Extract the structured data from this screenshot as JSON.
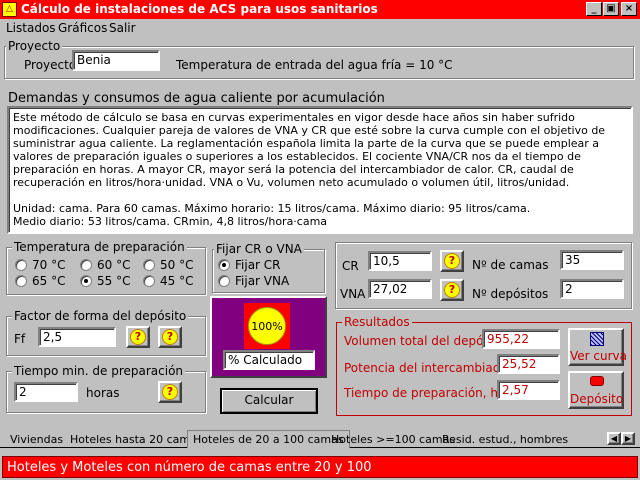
{
  "window": {
    "title": "Cálculo de instalaciones de ACS para usos sanitarios",
    "icon": "app-icon"
  },
  "menu": [
    "Listados",
    "Gráficos",
    "Salir"
  ],
  "proyecto": {
    "legend": "Proyecto",
    "label": "Proyecto:",
    "value": "Benia",
    "temp_text": "Temperatura de entrada del agua fría = 10 °C"
  },
  "demandas": {
    "heading": "Demandas y consumos de agua caliente por acumulación",
    "paragraph1": "Este método de cálculo se basa en curvas experimentales en vigor desde hace años sin haber sufrido modificaciones. Cualquier pareja de valores de VNA y CR que esté sobre la curva cumple con el objetivo de suministrar agua caliente. La reglamentación española limita la parte de la curva que se puede emplear a valores de preparación iguales o superiores a los establecidos. El cociente VNA/CR nos da el tiempo de preparación en horas. A mayor CR, mayor será la potencia del intercambiador de calor. CR, caudal de recuperación en litros/hora·unidad. VNA o Vu, volumen neto acumulado o volumen útil, litros/unidad.",
    "paragraph2_line1": "Unidad: cama. Para 60 camas. Máximo horario: 15 litros/cama. Máximo diario: 95 litros/cama.",
    "paragraph2_line2": "Medio diario: 53 litros/cama. CRmin, 4,8 litros/hora·cama"
  },
  "temperatura": {
    "legend": "Temperatura de preparación",
    "options": [
      {
        "label": "70 °C",
        "selected": false
      },
      {
        "label": "60 °C",
        "selected": false
      },
      {
        "label": "50 °C",
        "selected": false
      },
      {
        "label": "65 °C",
        "selected": false
      },
      {
        "label": "55 °C",
        "selected": true
      },
      {
        "label": "45 °C",
        "selected": false
      }
    ]
  },
  "fijar": {
    "legend": "Fijar CR o VNA",
    "options": [
      {
        "label": "Fijar CR",
        "selected": true
      },
      {
        "label": "Fijar VNA",
        "selected": false
      }
    ]
  },
  "factor": {
    "legend": "Factor de forma del depósito",
    "label": "Ff",
    "value": "2,5"
  },
  "tiempo_min": {
    "legend": "Tiempo min. de preparación",
    "value": "2",
    "unit": "horas"
  },
  "calc_panel": {
    "progress_text": "100%",
    "progress": 100,
    "caption": "% Calculado",
    "button": "Calcular"
  },
  "params": {
    "cr_label": "CR",
    "cr_value": "10,5",
    "vna_label": "VNA",
    "vna_value": "27,02",
    "camas_label": "Nº de camas",
    "camas_value": "35",
    "depositos_label": "Nº depósitos",
    "depositos_value": "2"
  },
  "resultados": {
    "legend": "Resultados",
    "volumen_label": "Volumen total del depósito, l",
    "volumen_value": "955,22",
    "potencia_label": "Potencia del intercambiador kW",
    "potencia_value": "25,52",
    "tiempo_label": "Tiempo de preparación, horas",
    "tiempo_value": "2,57",
    "ver_curva": "Ver curva",
    "deposito": "Depósito"
  },
  "tabs": [
    {
      "label": "Viviendas",
      "active": false
    },
    {
      "label": "Hoteles hasta 20 camas",
      "active": false
    },
    {
      "label": "Hoteles de 20 a 100 camas",
      "active": true
    },
    {
      "label": "Hoteles >=100 camas",
      "active": false
    },
    {
      "label": "Resid. estud., hombres",
      "active": false
    }
  ],
  "status": "Hoteles y Moteles con número de camas entre 20 y 100",
  "colors": {
    "title_bar": "#ff0000",
    "results_text": "#c00000",
    "calc_panel": "#800080",
    "progress_fill": "#ffff00"
  }
}
